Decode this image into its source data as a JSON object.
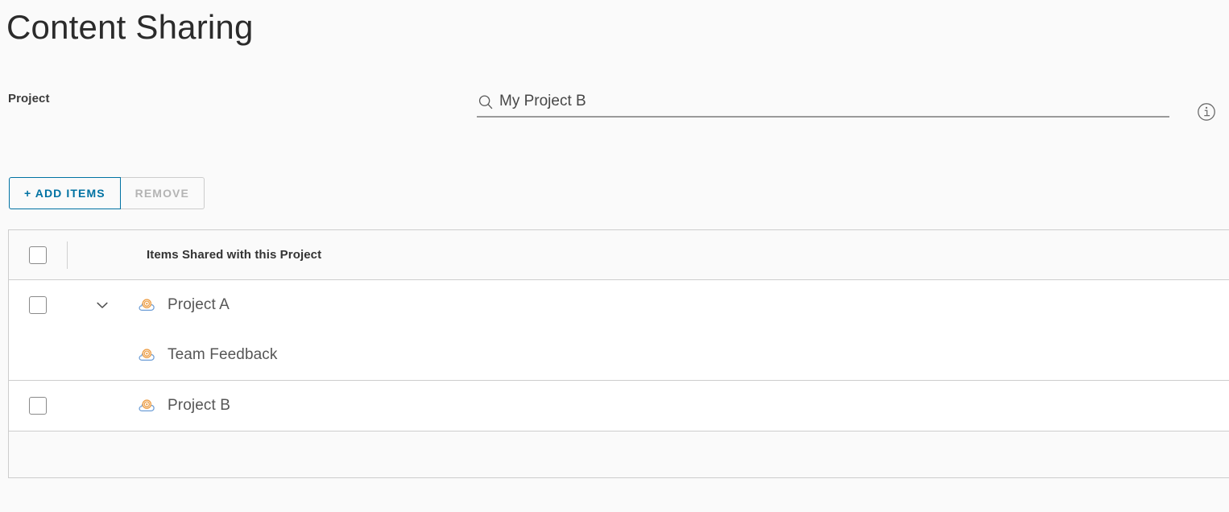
{
  "page": {
    "title": "Content Sharing",
    "background": "#fafafa"
  },
  "project_field": {
    "label": "Project",
    "search_icon": "search-icon",
    "value": "My Project B",
    "placeholder": "Search",
    "info_icon": "info-circle-icon"
  },
  "toolbar": {
    "add_items_label": "+ ADD ITEMS",
    "add_items_color": "#0072a3",
    "remove_label": "REMOVE",
    "remove_disabled_color": "#b4b4b4"
  },
  "table": {
    "header": {
      "select_all_checkbox": "",
      "column_title": "Items Shared with this Project"
    },
    "rows": [
      {
        "id": "project-a",
        "label": "Project A",
        "icon": "content-library-icon",
        "has_checkbox": true,
        "expanded": true,
        "caret": "chevron-down-icon",
        "children": [
          {
            "id": "team-feedback",
            "label": "Team Feedback",
            "icon": "content-library-icon",
            "has_checkbox": false
          }
        ]
      },
      {
        "id": "project-b",
        "label": "Project B",
        "icon": "content-library-icon",
        "has_checkbox": true,
        "expanded": false,
        "caret": "",
        "children": []
      }
    ],
    "footer_text": ""
  },
  "colors": {
    "accent": "#0072a3",
    "icon_orange": "#eda04a",
    "icon_blue": "#6e9ed6",
    "border": "#cdcdcd",
    "text": "#565656"
  }
}
